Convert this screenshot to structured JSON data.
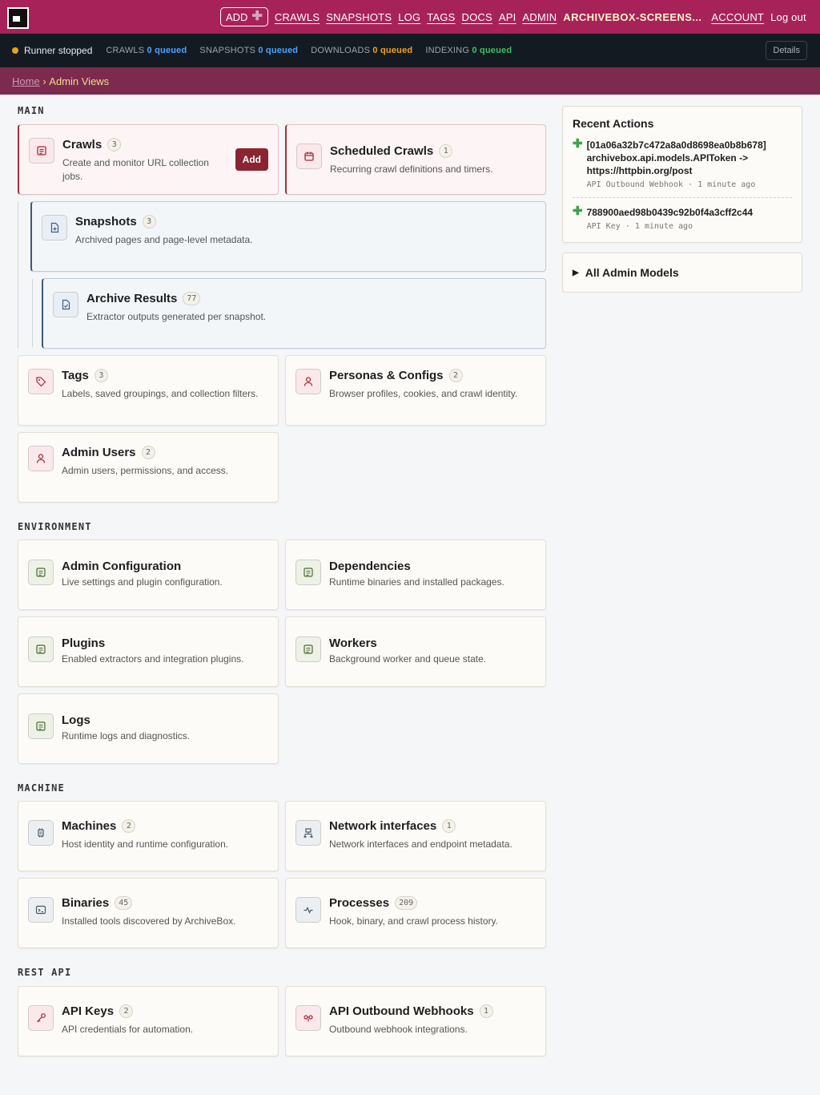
{
  "nav": {
    "add_label": "ADD",
    "links": [
      "CRAWLS",
      "SNAPSHOTS",
      "LOG",
      "TAGS",
      "DOCS",
      "API",
      "ADMIN"
    ],
    "username": "ARCHIVEBOX-SCREENS...",
    "account": "ACCOUNT",
    "logout": "Log out"
  },
  "status": {
    "runner": "Runner stopped",
    "crawls_label": "CRAWLS",
    "crawls_value": "0 queued",
    "snapshots_label": "SNAPSHOTS",
    "snapshots_value": "0 queued",
    "downloads_label": "DOWNLOADS",
    "downloads_value": "0 queued",
    "indexing_label": "INDEXING",
    "indexing_value": "0 queued",
    "details": "Details",
    "runner_color": "#e8a317"
  },
  "breadcrumb": {
    "home": "Home",
    "sep": "›",
    "current": "Admin Views"
  },
  "sections": {
    "main": "MAIN",
    "environment": "ENVIRONMENT",
    "machine": "MACHINE",
    "rest_api": "REST API"
  },
  "cards": {
    "crawls": {
      "title": "Crawls",
      "count": "3",
      "desc": "Create and monitor URL collection jobs.",
      "add": "Add",
      "icon": "crawl-icon"
    },
    "scheduled": {
      "title": "Scheduled Crawls",
      "count": "1",
      "desc": "Recurring crawl definitions and timers.",
      "icon": "calendar-icon"
    },
    "snapshots": {
      "title": "Snapshots",
      "count": "3",
      "desc": "Archived pages and page-level metadata.",
      "icon": "file-plus-icon"
    },
    "archive_results": {
      "title": "Archive Results",
      "count": "77",
      "desc": "Extractor outputs generated per snapshot.",
      "icon": "file-check-icon"
    },
    "tags": {
      "title": "Tags",
      "count": "3",
      "desc": "Labels, saved groupings, and collection filters.",
      "icon": "tag-icon"
    },
    "personas": {
      "title": "Personas & Configs",
      "count": "2",
      "desc": "Browser profiles, cookies, and crawl identity.",
      "icon": "person-icon"
    },
    "admin_users": {
      "title": "Admin Users",
      "count": "2",
      "desc": "Admin users, permissions, and access.",
      "icon": "user-icon"
    },
    "admin_config": {
      "title": "Admin Configuration",
      "desc": "Live settings and plugin configuration.",
      "icon": "list-icon"
    },
    "dependencies": {
      "title": "Dependencies",
      "desc": "Runtime binaries and installed packages.",
      "icon": "list-icon"
    },
    "plugins": {
      "title": "Plugins",
      "desc": "Enabled extractors and integration plugins.",
      "icon": "list-icon"
    },
    "workers": {
      "title": "Workers",
      "desc": "Background worker and queue state.",
      "icon": "list-icon"
    },
    "logs": {
      "title": "Logs",
      "desc": "Runtime logs and diagnostics.",
      "icon": "list-icon"
    },
    "machines": {
      "title": "Machines",
      "count": "2",
      "desc": "Host identity and runtime configuration.",
      "icon": "chip-icon"
    },
    "network": {
      "title": "Network interfaces",
      "count": "1",
      "desc": "Network interfaces and endpoint metadata.",
      "icon": "network-icon"
    },
    "binaries": {
      "title": "Binaries",
      "count": "45",
      "desc": "Installed tools discovered by ArchiveBox.",
      "icon": "terminal-icon"
    },
    "processes": {
      "title": "Processes",
      "count": "209",
      "desc": "Hook, binary, and crawl process history.",
      "icon": "pulse-icon"
    },
    "api_keys": {
      "title": "API Keys",
      "count": "2",
      "desc": "API credentials for automation.",
      "icon": "key-icon"
    },
    "webhooks": {
      "title": "API Outbound Webhooks",
      "count": "1",
      "desc": "Outbound webhook integrations.",
      "icon": "webhook-icon"
    }
  },
  "recent": {
    "title": "Recent Actions",
    "items": [
      {
        "text": "[01a06a32b7c472a8a0d8698ea0b8b678] archivebox.api.models.APIToken -> https://httpbin.org/post",
        "type": "API Outbound Webhook",
        "sep": "·",
        "time": "1 minute ago"
      },
      {
        "text": "788900aed98b0439c92b0f4a3cff2c44",
        "type": "API Key",
        "sep": "·",
        "time": "1 minute ago"
      }
    ]
  },
  "all_models": "All Admin Models"
}
